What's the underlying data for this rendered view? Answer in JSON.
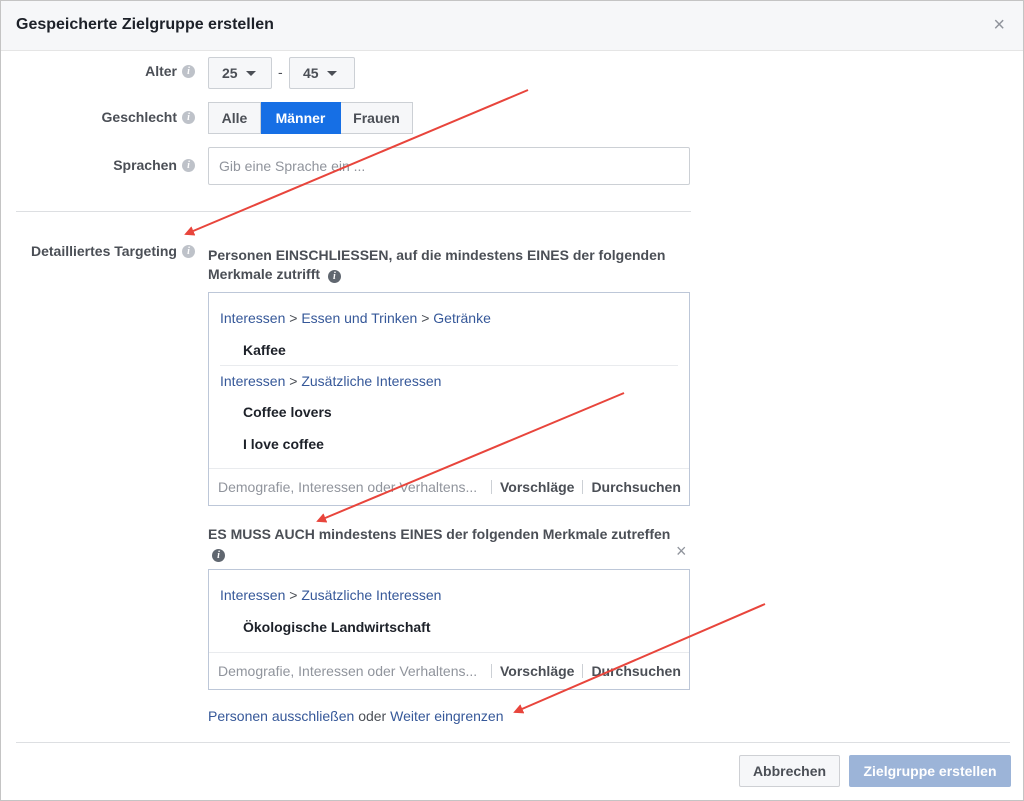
{
  "dialog": {
    "title": "Gespeicherte Zielgruppe erstellen",
    "close_symbol": "×"
  },
  "age": {
    "label": "Alter",
    "from": "25",
    "to": "45",
    "separator": "-"
  },
  "gender": {
    "label": "Geschlecht",
    "options": [
      "Alle",
      "Männer",
      "Frauen"
    ],
    "selected": "Männer"
  },
  "languages": {
    "label": "Sprachen",
    "placeholder": "Gib eine Sprache ein ..."
  },
  "targeting": {
    "label": "Detailliertes Targeting",
    "include_desc": "Personen EINSCHLIESSEN, auf die mindestens EINES der folgenden Merkmale zutrifft",
    "include_groups": [
      {
        "path": [
          "Interessen",
          "Essen und Trinken",
          "Getränke"
        ],
        "items": [
          "Kaffee"
        ]
      },
      {
        "path": [
          "Interessen",
          "Zusätzliche Interessen"
        ],
        "items": [
          "Coffee lovers",
          "I love coffee"
        ]
      }
    ],
    "must_desc": "ES MUSS AUCH mindestens EINES der folgenden Merkmale zutreffen",
    "must_groups": [
      {
        "path": [
          "Interessen",
          "Zusätzliche Interessen"
        ],
        "items": [
          "Ökologische Landwirtschaft"
        ]
      }
    ],
    "search_placeholder": "Demografie, Interessen oder Verhaltens...",
    "suggestions_label": "Vorschläge",
    "browse_label": "Durchsuchen",
    "path_separator": ">",
    "exclude_link": "Personen ausschließen",
    "or_text": "oder",
    "narrow_link": "Weiter eingrenzen"
  },
  "footer": {
    "cancel": "Abbrechen",
    "create": "Zielgruppe erstellen"
  },
  "icons": {
    "info": "i",
    "caret": "caret-down-icon"
  },
  "colors": {
    "accent": "#166fe5",
    "link": "#365899",
    "annotation_arrow": "#e8453c"
  }
}
